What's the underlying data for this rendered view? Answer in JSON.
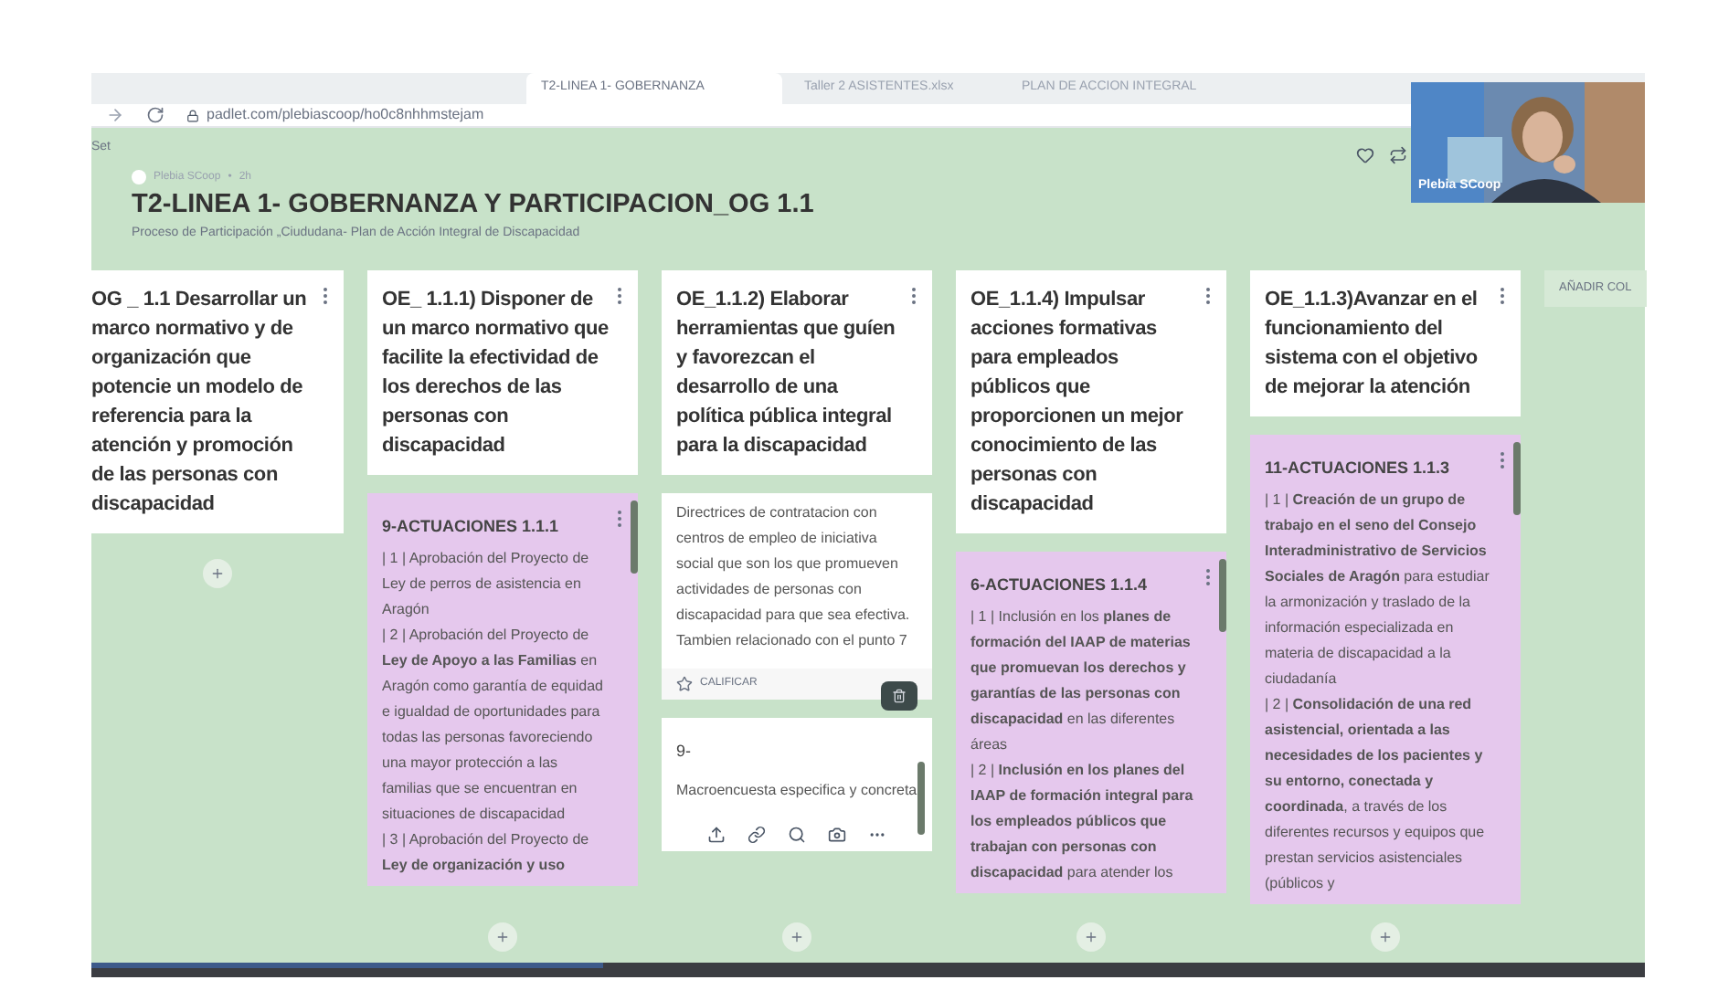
{
  "browser": {
    "tabs": [
      {
        "title": "T2-LINEA 1- GOBERNANZA",
        "selected": true
      },
      {
        "title": "Taller 2 ASISTENTES.xlsx",
        "selected": false
      },
      {
        "title": "PLAN DE ACCION INTEGRAL",
        "selected": false
      }
    ],
    "url": "padlet.com/plebiascoop/ho0c8nhhmstejam"
  },
  "board": {
    "corner_label": "Set",
    "author": "Plebia SCoop",
    "separator": "•",
    "time": "2h",
    "title": "T2-LINEA 1- GOBERNANZA Y PARTICIPACION_OG 1.1",
    "subtitle": "Proceso de Participación „Ciududana- Plan de Acción Integral de Discapacidad"
  },
  "columns": [
    {
      "header": "OG _ 1.1 Desarrollar un marco normativo y de organización que potencie un modelo de referencia para la atención y promoción de las personas con discapacidad"
    },
    {
      "header": "OE_ 1.1.1) Disponer de un marco normativo que facilite la efectividad de los derechos de las personas con discapacidad",
      "posts": [
        {
          "kind": "actions",
          "title": "9-ACTUACIONES 1.1.1",
          "paragraphs": [
            "| 1 | Aprobación del Proyecto de Ley de perros de asistencia en Aragón",
            "| 2 | Aprobación del Proyecto de **Ley de Apoyo a las Familias** en Aragón como garantía de equidad e igualdad de oportunidades para todas las personas favoreciendo una mayor protección a las familias que se encuentran en situaciones de discapacidad",
            "| 3 | Aprobación del Proyecto de **Ley de organización y uso**"
          ]
        }
      ]
    },
    {
      "header": "OE_1.1.2) Elaborar herramientas que guíen y favorezcan el desarrollo de una política pública integral para la discapacidad",
      "posts": [
        {
          "kind": "note",
          "paragraphs": [
            "Directrices de contratacion con centros de empleo de iniciativa social que son los que promueven actividades de personas con discapacidad para que sea efectiva. Tambien relacionado con el punto 7"
          ],
          "rate_label": "CALIFICAR"
        },
        {
          "kind": "editor",
          "title": "9-",
          "paragraphs": [
            "Macroencuesta especifica y concreta"
          ]
        }
      ]
    },
    {
      "header": "OE_1.1.4) Impulsar acciones formativas para empleados públicos que proporcionen un mejor conocimiento de las personas con discapacidad",
      "posts": [
        {
          "kind": "actions",
          "title": "6-ACTUACIONES 1.1.4",
          "paragraphs": [
            "| 1 | Inclusión en los **planes de formación del IAAP de materias que promuevan los derechos y garantías de las personas con discapacidad** en las diferentes áreas",
            "| 2 | **Inclusión en los planes del IAAP de formación integral para los empleados públicos que trabajan con personas con discapacidad** para atender los"
          ]
        }
      ]
    },
    {
      "header": "OE_1.1.3)Avanzar en el funcionamiento del sistema con el objetivo de mejorar la atención",
      "posts": [
        {
          "kind": "actions",
          "title": "11-ACTUACIONES 1.1.3",
          "paragraphs": [
            "| 1 | **Creación de un grupo de trabajo en el seno del Consejo Interadministrativo de Servicios Sociales de Aragón** para estudiar la armonización y traslado de la información especializada en materia de discapacidad a la ciudadanía",
            "| 2 | **Consolidación de una red asistencial, orientada a las necesidades de los pacientes y su entorno, conectada y coordinada**, a través de los diferentes recursos y equipos que prestan servicios asistenciales (públicos y"
          ]
        }
      ]
    }
  ],
  "add_column_label": "AÑADIR COL",
  "video": {
    "name": "Plebia SCoop"
  }
}
